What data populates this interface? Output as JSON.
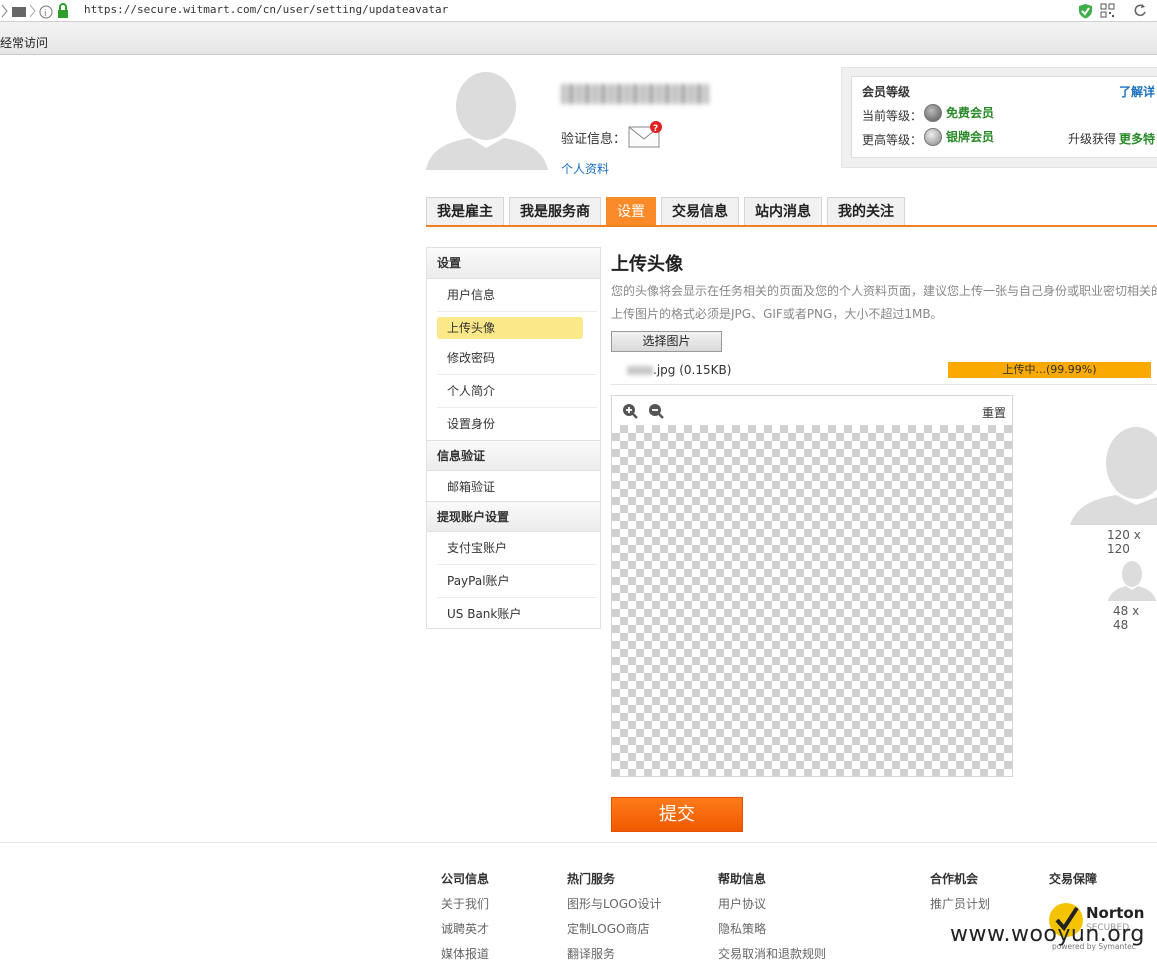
{
  "browser": {
    "url": "https://secure.witmart.com/cn/user/setting/updateavatar",
    "bookmark_text": "经常访问"
  },
  "profile": {
    "verify_label": "验证信息：",
    "profile_link": "个人资料"
  },
  "membership": {
    "title": "会员等级",
    "learn_more": "了解详",
    "current_label": "当前等级：",
    "current_value": "免费会员",
    "higher_label": "更高等级：",
    "higher_value": "银牌会员",
    "upgrade_text": "升级获得",
    "upgrade_link": "更多特"
  },
  "tabs": [
    {
      "label": "我是雇主"
    },
    {
      "label": "我是服务商"
    },
    {
      "label": "设置"
    },
    {
      "label": "交易信息"
    },
    {
      "label": "站内消息"
    },
    {
      "label": "我的关注"
    }
  ],
  "sidebar": {
    "sections": [
      {
        "title": "设置",
        "items": [
          "用户信息",
          "上传头像",
          "修改密码",
          "个人简介",
          "设置身份"
        ]
      },
      {
        "title": "信息验证",
        "items": [
          "邮箱验证"
        ]
      },
      {
        "title": "提现账户设置",
        "items": [
          "支付宝账户",
          "PayPal账户",
          "US Bank账户"
        ]
      }
    ]
  },
  "main": {
    "title": "上传头像",
    "desc1": "您的头像将会显示在任务相关的页面及您的个人资料页面，建议您上传一张与自己身份或职业密切相关的",
    "desc2": "上传图片的格式必须是JPG、GIF或者PNG，大小不超过1MB。",
    "choose_button": "选择图片",
    "file_name": ".jpg (0.15KB)",
    "progress_text": "上传中...(99.99%)",
    "progress_value": 99.99,
    "reset": "重置",
    "preview_large": "120 x 120",
    "preview_small": "48 x 48",
    "submit": "提交"
  },
  "footer": {
    "columns": [
      {
        "title": "公司信息",
        "links": [
          "关于我们",
          "诚聘英才",
          "媒体报道"
        ]
      },
      {
        "title": "热门服务",
        "links": [
          "图形与LOGO设计",
          "定制LOGO商店",
          "翻译服务"
        ]
      },
      {
        "title": "帮助信息",
        "links": [
          "用户协议",
          "隐私策略",
          "交易取消和退款规则"
        ]
      },
      {
        "title": "合作机会",
        "links": [
          "推广员计划"
        ]
      },
      {
        "title": "交易保障",
        "links": []
      }
    ],
    "norton_text": "Norton",
    "norton_secured": "SECURED",
    "norton_powered": "powered by Symantec",
    "watermark": "www.wooyun.org"
  },
  "colors": {
    "accent": "#fb8a28",
    "progress": "#f9a900",
    "link": "#1a6fbf",
    "green": "#2a8a2a"
  }
}
